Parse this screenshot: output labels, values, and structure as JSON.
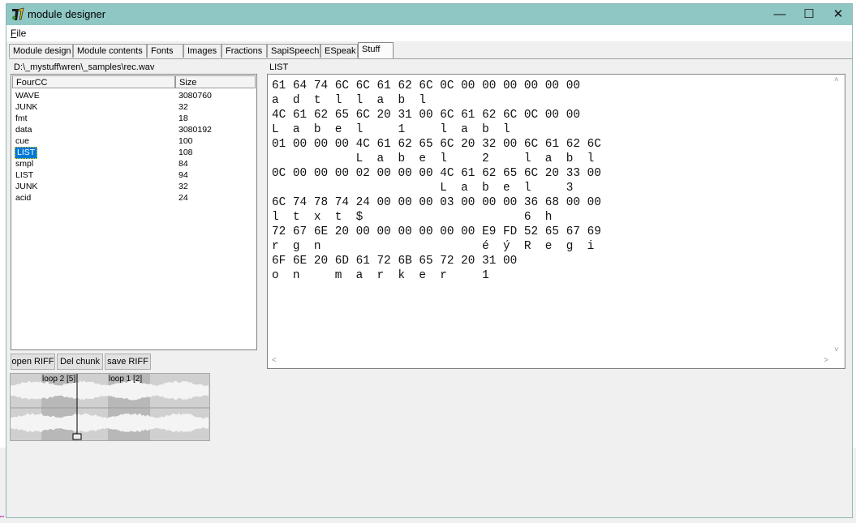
{
  "window": {
    "title": "module designer",
    "minimize_label": "—",
    "maximize_label": "☐",
    "close_label": "✕"
  },
  "menu": {
    "file_prefix": "F",
    "file_rest": "ile"
  },
  "tabs": [
    {
      "label": "Module design"
    },
    {
      "label": "Module contents"
    },
    {
      "label": "Fonts"
    },
    {
      "label": "Images"
    },
    {
      "label": "Fractions"
    },
    {
      "label": "SapiSpeech"
    },
    {
      "label": "ESpeak"
    },
    {
      "label": "Stuff",
      "active": true
    }
  ],
  "path": "D:\\_mystuff\\wren\\_samples\\rec.wav",
  "chunk_list": {
    "headers": [
      "FourCC",
      "Size"
    ],
    "rows": [
      {
        "fourcc": "WAVE",
        "size": "3080760"
      },
      {
        "fourcc": "JUNK",
        "size": "32"
      },
      {
        "fourcc": "fmt",
        "size": "18"
      },
      {
        "fourcc": "data",
        "size": "3080192"
      },
      {
        "fourcc": "cue",
        "size": "100"
      },
      {
        "fourcc": "LIST",
        "size": "108",
        "selected": true
      },
      {
        "fourcc": "smpl",
        "size": "84"
      },
      {
        "fourcc": "LIST",
        "size": "94"
      },
      {
        "fourcc": "JUNK",
        "size": "32"
      },
      {
        "fourcc": "acid",
        "size": "24"
      }
    ]
  },
  "buttons": {
    "open_riff": "open RIFF",
    "del_chunk": "Del chunk",
    "save_riff": "save RIFF"
  },
  "waveform": {
    "loop_labels": [
      "loop 2 [5]",
      "loop 1 [2]"
    ]
  },
  "chunk_view": {
    "label": "LIST",
    "lines": [
      "61 64 74 6C 6C 61 62 6C 0C 00 00 00 00 00 00",
      "a  d  t  l  l  a  b  l",
      "4C 61 62 65 6C 20 31 00 6C 61 62 6C 0C 00 00",
      "L  a  b  e  l     1     l  a  b  l",
      "01 00 00 00 4C 61 62 65 6C 20 32 00 6C 61 62 6C",
      "            L  a  b  e  l     2     l  a  b  l",
      "0C 00 00 00 02 00 00 00 4C 61 62 65 6C 20 33 00",
      "                        L  a  b  e  l     3",
      "6C 74 78 74 24 00 00 00 03 00 00 00 36 68 00 00",
      "l  t  x  t  $                       6  h",
      "72 67 6E 20 00 00 00 00 00 00 E9 FD 52 65 67 69",
      "r  g  n                       é  ý  R  e  g  i",
      "6F 6E 20 6D 61 72 6B 65 72 20 31 00",
      "o  n     m  a  r  k  e  r     1"
    ]
  }
}
